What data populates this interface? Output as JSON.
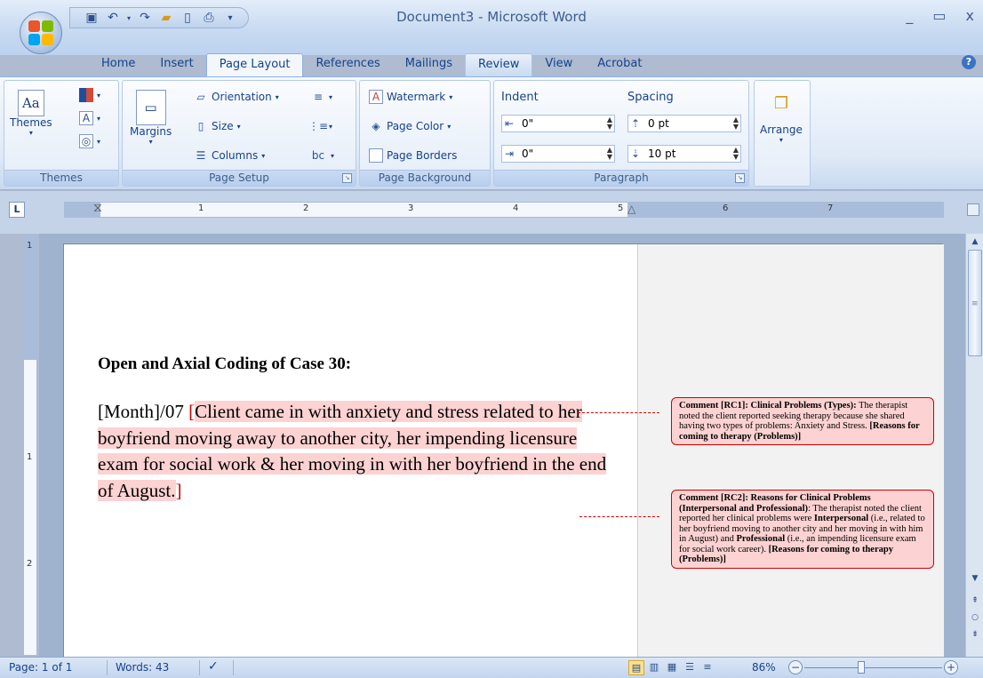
{
  "window": {
    "title": "Document3 - Microsoft Word",
    "minimize": "_",
    "restore": "▭",
    "close": "x"
  },
  "quick_access": {
    "icons": [
      "save-icon",
      "undo-icon",
      "redo-icon",
      "open-icon",
      "new-icon",
      "print-icon",
      "customize-icon"
    ]
  },
  "tabs": [
    {
      "label": "Home"
    },
    {
      "label": "Insert"
    },
    {
      "label": "Page Layout",
      "active": true
    },
    {
      "label": "References"
    },
    {
      "label": "Mailings"
    },
    {
      "label": "Review"
    },
    {
      "label": "View"
    },
    {
      "label": "Acrobat"
    }
  ],
  "ribbon": {
    "themes": {
      "label": "Themes",
      "group": "Themes"
    },
    "page_setup": {
      "margins": "Margins",
      "orientation": "Orientation",
      "size": "Size",
      "columns": "Columns",
      "group": "Page Setup"
    },
    "page_background": {
      "watermark": "Watermark",
      "page_color": "Page Color",
      "page_borders": "Page Borders",
      "group": "Page Background"
    },
    "paragraph": {
      "indent_header": "Indent",
      "indent_left": "0\"",
      "indent_right": "0\"",
      "spacing_header": "Spacing",
      "spacing_before": "0 pt",
      "spacing_after": "10 pt",
      "group": "Paragraph"
    },
    "arrange": {
      "label": "Arrange"
    }
  },
  "ruler": {
    "numbers": [
      "1",
      "2",
      "3",
      "4",
      "5",
      "6",
      "7"
    ],
    "vnumbers": [
      "1",
      "1",
      "2"
    ]
  },
  "document": {
    "heading": "Open and Axial Coding of Case 30:",
    "prefix": "[Month]/07 ",
    "highlighted": "Client came in with anxiety and stress related to her boyfriend moving away to another city, her impending licensure exam for social work & her moving in with her boyfriend in the end of August.",
    "comments": [
      {
        "id": "Comment [RC1]:",
        "title": " Clinical Problems (Types):",
        "text": " The therapist noted the client reported seeking therapy because she shared having two types of problems: Anxiety and Stress. ",
        "tag": "[Reasons for coming to therapy (Problems)]"
      },
      {
        "id": "Comment [RC2]:",
        "title": " Reasons for Clinical Problems (Interpersonal and Professional)",
        "text1": ": The therapist noted the client reported her clinical problems were ",
        "bold1": "Interpersonal",
        "text2": " (i.e., related to her boyfriend moving to another city and her moving in with him in August) and ",
        "bold2": "Professional",
        "text3": " (i.e., an impending licensure exam for social work career). ",
        "tag": "[Reasons for coming to therapy (Problems)]"
      }
    ]
  },
  "status": {
    "page": "Page: 1 of 1",
    "words": "Words: 43",
    "zoom": "86%"
  },
  "colors": {
    "comment_border": "#d00000",
    "comment_fill": "#fcd2d2",
    "ribbon_text": "#15428b"
  }
}
